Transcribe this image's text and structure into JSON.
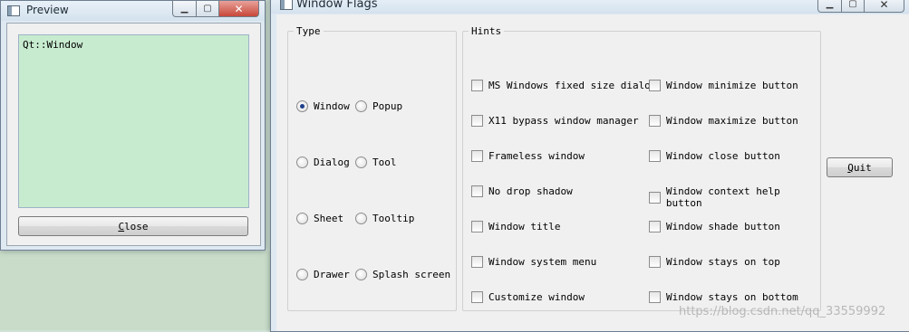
{
  "preview": {
    "title": "Preview",
    "text": "Qt::Window",
    "close_label": "Close"
  },
  "flags": {
    "title": "Window Flags",
    "type_group": {
      "title": "Type",
      "options": [
        {
          "label": "Window",
          "checked": true
        },
        {
          "label": "Popup",
          "checked": false
        },
        {
          "label": "Dialog",
          "checked": false
        },
        {
          "label": "Tool",
          "checked": false
        },
        {
          "label": "Sheet",
          "checked": false
        },
        {
          "label": "Tooltip",
          "checked": false
        },
        {
          "label": "Drawer",
          "checked": false
        },
        {
          "label": "Splash screen",
          "checked": false
        }
      ]
    },
    "hints_group": {
      "title": "Hints",
      "left": [
        {
          "label": "MS Windows fixed size dialog",
          "checked": false
        },
        {
          "label": "X11 bypass window manager",
          "checked": false
        },
        {
          "label": "Frameless window",
          "checked": false
        },
        {
          "label": "No drop shadow",
          "checked": false
        },
        {
          "label": "Window title",
          "checked": false
        },
        {
          "label": "Window system menu",
          "checked": false
        },
        {
          "label": "Customize window",
          "checked": false
        }
      ],
      "right": [
        {
          "label": "Window minimize button",
          "checked": false
        },
        {
          "label": "Window maximize button",
          "checked": false
        },
        {
          "label": "Window close button",
          "checked": false
        },
        {
          "label": "Window context help button",
          "checked": false
        },
        {
          "label": "Window shade button",
          "checked": false
        },
        {
          "label": "Window stays on top",
          "checked": false
        },
        {
          "label": "Window stays on bottom",
          "checked": false
        }
      ]
    },
    "quit_label": "Quit"
  },
  "watermark": "https://blog.csdn.net/qq_33559992",
  "icons": {
    "window": "window-icon",
    "minimize": "minimize-icon",
    "maximize": "maximize-icon",
    "close": "close-icon"
  }
}
